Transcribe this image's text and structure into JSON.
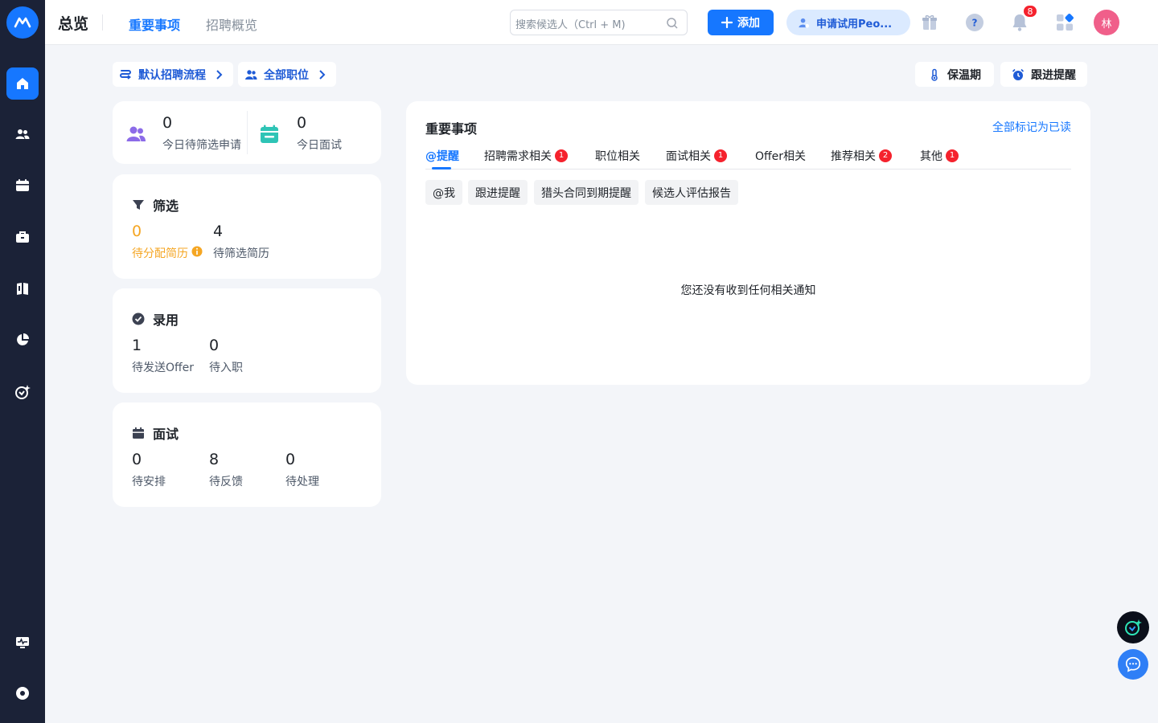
{
  "sidebar": {
    "logo": "mokahr-logo-icon",
    "items": [
      {
        "icon": "home-icon",
        "active": true
      },
      {
        "icon": "people-icon",
        "active": false
      },
      {
        "icon": "calendar-icon",
        "active": false
      },
      {
        "icon": "briefcase-icon",
        "active": false
      },
      {
        "icon": "book-icon",
        "active": false
      },
      {
        "icon": "pie-chart-icon",
        "active": false
      },
      {
        "icon": "ai-sparkle-icon",
        "active": false
      }
    ],
    "bottom_items": [
      {
        "icon": "monitor-pulse-icon"
      },
      {
        "icon": "settings-circle-icon"
      }
    ]
  },
  "header": {
    "title": "总览",
    "tabs": [
      {
        "label": "重要事项",
        "active": true
      },
      {
        "label": "招聘概览",
        "active": false
      }
    ],
    "search": {
      "placeholder": "搜索候选人（Ctrl + M)"
    },
    "add_button": "添加",
    "trial_button": "申请试用Peo...",
    "notification_count": "8",
    "avatar_text": "林"
  },
  "filters": {
    "process": "默认招聘流程",
    "positions": "全部职位",
    "warranty": "保温期",
    "followup": "跟进提醒"
  },
  "today": {
    "pending_screen": {
      "value": "0",
      "label": "今日待筛选申请"
    },
    "interviews": {
      "value": "0",
      "label": "今日面试"
    }
  },
  "screening": {
    "title": "筛选",
    "unassigned": {
      "value": "0",
      "label": "待分配简历"
    },
    "pending": {
      "value": "4",
      "label": "待筛选简历"
    }
  },
  "hiring": {
    "title": "录用",
    "offer": {
      "value": "1",
      "label": "待发送Offer"
    },
    "onboard": {
      "value": "0",
      "label": "待入职"
    }
  },
  "interview": {
    "title": "面试",
    "schedule": {
      "value": "0",
      "label": "待安排"
    },
    "feedback": {
      "value": "8",
      "label": "待反馈"
    },
    "process": {
      "value": "0",
      "label": "待处理"
    }
  },
  "panel": {
    "title": "重要事项",
    "mark_all_read": "全部标记为已读",
    "tabs": [
      {
        "label": "@提醒",
        "badge": "",
        "active": true
      },
      {
        "label": "招聘需求相关",
        "badge": "1",
        "active": false
      },
      {
        "label": "职位相关",
        "badge": "",
        "active": false
      },
      {
        "label": "面试相关",
        "badge": "1",
        "active": false
      },
      {
        "label": "Offer相关",
        "badge": "",
        "active": false
      },
      {
        "label": "推荐相关",
        "badge": "2",
        "active": false
      },
      {
        "label": "其他",
        "badge": "1",
        "active": false
      }
    ],
    "subtabs": [
      "@我",
      "跟进提醒",
      "猎头合同到期提醒",
      "候选人评估报告"
    ],
    "empty_message": "您还没有收到任何相关通知"
  },
  "colors": {
    "primary": "#1677ff",
    "sidebar_bg": "#1b2237",
    "warning": "#f5a623",
    "badge_red": "#f5222d",
    "avatar": "#f05f8a"
  }
}
